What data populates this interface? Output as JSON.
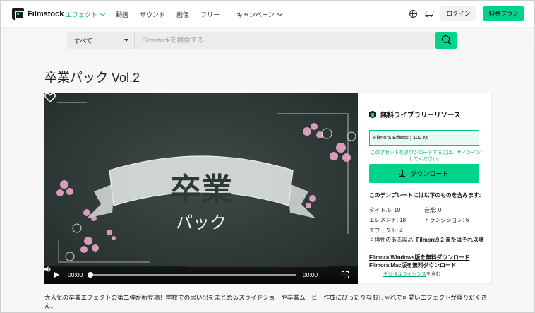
{
  "header": {
    "logo_text": "Filmstock",
    "nav": [
      {
        "label": "エフェクト",
        "active": true,
        "has_menu": true
      },
      {
        "label": "動画",
        "active": false,
        "has_menu": false
      },
      {
        "label": "サウンド",
        "active": false,
        "has_menu": false
      },
      {
        "label": "画像",
        "active": false,
        "has_menu": false
      },
      {
        "label": "フリー",
        "active": false,
        "has_menu": false
      },
      {
        "label": "キャンペーン",
        "active": false,
        "has_menu": true
      }
    ],
    "login_label": "ログイン",
    "plan_label": "料金プラン",
    "icons": [
      "globe-icon",
      "cart-icon"
    ]
  },
  "search": {
    "category": "すべて",
    "placeholder": "Filmstockを検索する",
    "value": ""
  },
  "main": {
    "title": "卒業パック Vol.2",
    "player": {
      "current_time": "00:00",
      "duration": "00:00",
      "progress": 0,
      "artwork_text_1": "卒業",
      "artwork_text_2": "パック"
    },
    "side": {
      "heading": "無料ライブラリーリソース",
      "selected_resource": "Filmora Effects | 102 M",
      "signin_note": "このアセットをダウンロードするには、サインインしてください。",
      "download_label": "ダウンロード",
      "contains_heading": "このテンプレートには以下のものを含みます:",
      "stats": [
        [
          "タイトル: 10",
          "音楽: 0"
        ],
        [
          "エレメント: 18",
          "トランジション: 6"
        ],
        [
          "エフェクト: 4",
          ""
        ]
      ],
      "compat_label": "互換性のある製品:",
      "compat_value": "Filmora9.2 またはそれ以降",
      "win_link": "Filmora Windows版を無料ダウンロード",
      "mac_link": "Filmora Mac版を無料ダウンロード",
      "license_link": "デジタルライセンス",
      "license_suffix": "を含む"
    },
    "description": "大人気の卒業エフェクトの第二弾が新登場！学校での思い出をまとめるスライドショーや卒業ムービー作成にぴったりなおしゃれで可愛いエフェクトが盛りだくさん。"
  },
  "colors": {
    "accent": "#00d48a",
    "accent_text": "#00b377",
    "chalkboard": "#2b3533"
  }
}
